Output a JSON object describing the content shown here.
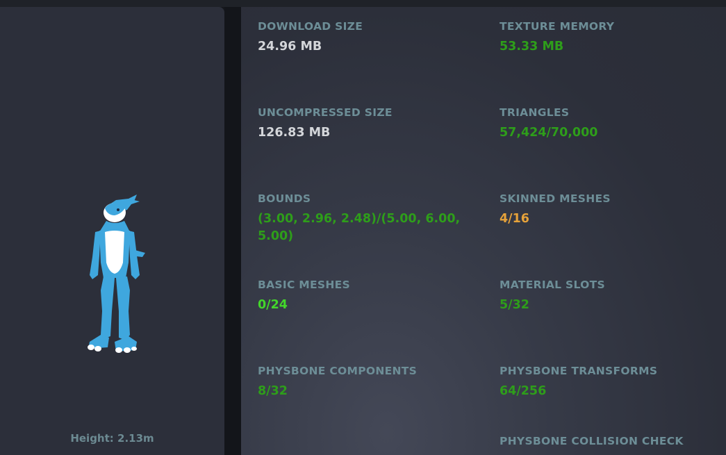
{
  "avatar": {
    "height_text": "Height: 2.13m"
  },
  "stats": {
    "download_size": {
      "label": "DOWNLOAD SIZE",
      "value": "24.96 MB"
    },
    "texture_memory": {
      "label": "TEXTURE MEMORY",
      "value": "53.33 MB"
    },
    "uncompressed_size": {
      "label": "UNCOMPRESSED SIZE",
      "value": "126.83 MB"
    },
    "triangles": {
      "label": "TRIANGLES",
      "value": "57,424/70,000"
    },
    "bounds": {
      "label": "BOUNDS",
      "value": "(3.00, 2.96, 2.48)/(5.00, 6.00, 5.00)"
    },
    "skinned_meshes": {
      "label": "SKINNED MESHES",
      "value": "4/16"
    },
    "basic_meshes": {
      "label": "BASIC MESHES",
      "value": "0/24"
    },
    "material_slots": {
      "label": "MATERIAL SLOTS",
      "value": "5/32"
    },
    "physbone_components": {
      "label": "PHYSBONE COMPONENTS",
      "value": "8/32"
    },
    "physbone_transforms": {
      "label": "PHYSBONE TRANSFORMS",
      "value": "64/256"
    },
    "physbone_collision_check": {
      "label": "PHYSBONE COLLISION CHECK",
      "value": ""
    }
  },
  "colors": {
    "neutral": "#d4d6da",
    "good": "#2e9e1a",
    "excellent": "#43d62b",
    "medium": "#e6a23a",
    "label": "#6d8e97"
  }
}
